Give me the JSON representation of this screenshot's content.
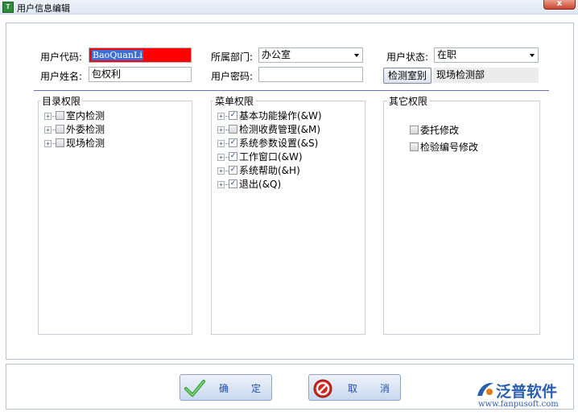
{
  "window": {
    "title": "用户信息编辑",
    "icon_text": "T",
    "close_label": "x"
  },
  "form": {
    "user_code_label": "用户代码:",
    "user_code_value": "BaoQuanLi",
    "department_label": "所属部门:",
    "department_value": "办公室",
    "status_label": "用户状态:",
    "status_value": "在职",
    "user_name_label": "用户姓名:",
    "user_name_value": "包权利",
    "password_label": "用户密码:",
    "password_value": "",
    "lab_button_label": "检测室别",
    "lab_value": "现场检测部"
  },
  "catalog_permissions": {
    "title": "目录权限",
    "items": [
      {
        "label": "室内检测",
        "checked": false
      },
      {
        "label": "外委检测",
        "checked": false
      },
      {
        "label": "现场检测",
        "checked": false
      }
    ]
  },
  "menu_permissions": {
    "title": "菜单权限",
    "items": [
      {
        "label": "基本功能操作(&W)",
        "checked": true
      },
      {
        "label": "检测收费管理(&M)",
        "checked": false
      },
      {
        "label": "系统参数设置(&S)",
        "checked": true
      },
      {
        "label": "工作窗口(&W)",
        "checked": true
      },
      {
        "label": "系统帮助(&H)",
        "checked": true
      },
      {
        "label": "退出(&Q)",
        "checked": true
      }
    ]
  },
  "other_permissions": {
    "title": "其它权限",
    "items": [
      {
        "label": "委托修改",
        "checked": false
      },
      {
        "label": "检验编号修改",
        "checked": false
      }
    ]
  },
  "buttons": {
    "ok_label": "确定",
    "cancel_label": "取消"
  },
  "logo": {
    "name": "泛普软件",
    "url": "www.fanpusoft.com"
  },
  "colors": {
    "accent": "#2a5fb0",
    "code_field_bg": "#ff0000",
    "selection": "#3b6fd4"
  }
}
